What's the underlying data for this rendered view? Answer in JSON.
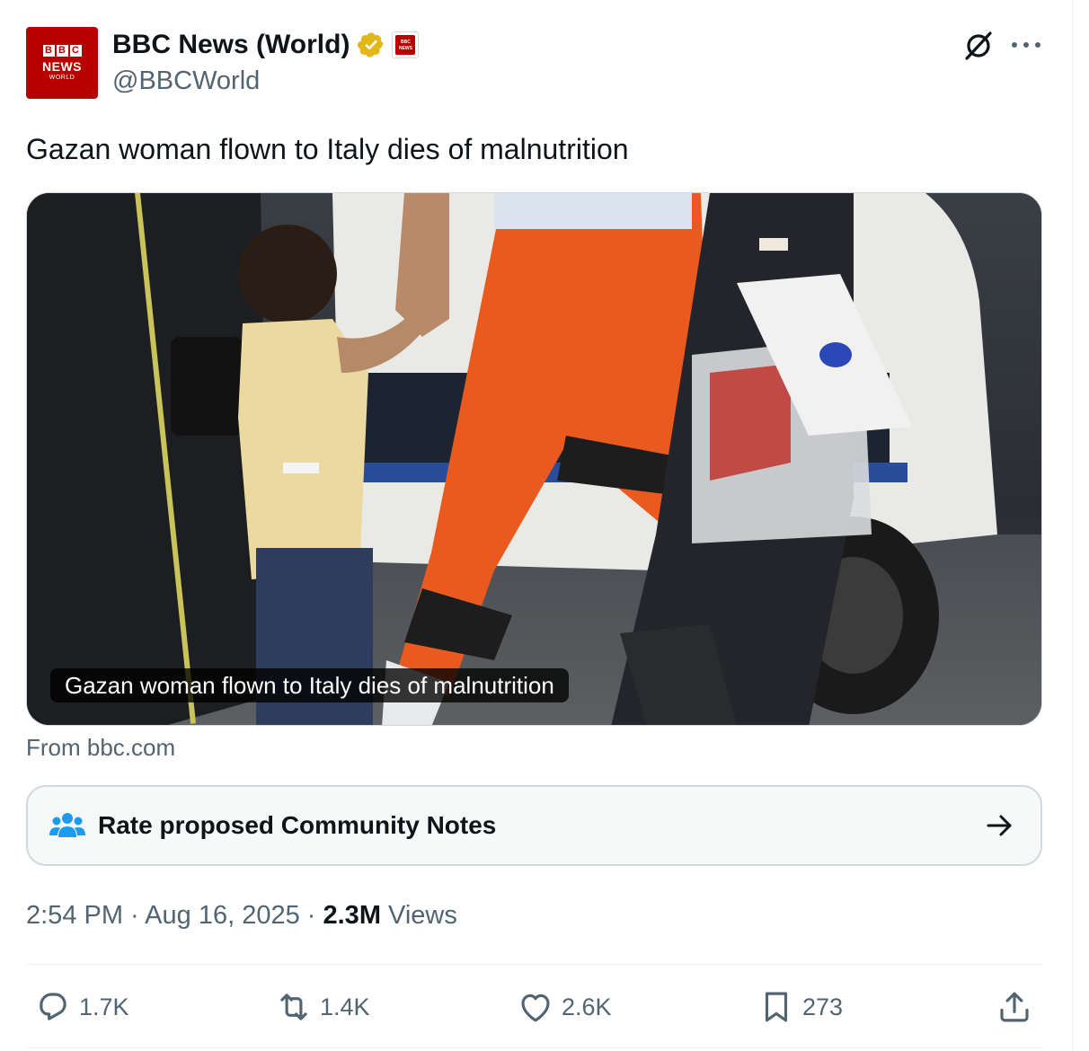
{
  "author": {
    "display_name": "BBC News (World)",
    "handle": "@BBCWorld",
    "avatar": {
      "blocks": [
        "B",
        "B",
        "C"
      ],
      "line1": "NEWS",
      "line2": "WORLD"
    },
    "affiliate_badge": {
      "line1": "BBC",
      "line2": "NEWS"
    }
  },
  "tweet": {
    "text": "Gazan woman flown to Italy dies of malnutrition"
  },
  "card": {
    "caption": "Gazan woman flown to Italy dies of malnutrition",
    "source": "From bbc.com"
  },
  "community_notes": {
    "label": "Rate proposed Community Notes"
  },
  "meta": {
    "time": "2:54 PM",
    "separator": " · ",
    "date": "Aug 16, 2025",
    "views_count": "2.3M",
    "views_label": " Views"
  },
  "actions": {
    "replies": "1.7K",
    "reposts": "1.4K",
    "likes": "2.6K",
    "bookmarks": "273"
  },
  "icons": {
    "verified": "verified-gold-badge-icon",
    "grok": "grok-icon",
    "more": "more-icon",
    "community": "community-notes-icon",
    "arrow": "arrow-right-icon",
    "reply": "reply-icon",
    "repost": "repost-icon",
    "like": "heart-icon",
    "bookmark": "bookmark-icon",
    "share": "share-icon"
  },
  "colors": {
    "brand_red": "#b80000",
    "verified_gold": "#e2b719",
    "text_primary": "#0f1419",
    "text_secondary": "#536471",
    "community_blue": "#1d9bf0"
  }
}
